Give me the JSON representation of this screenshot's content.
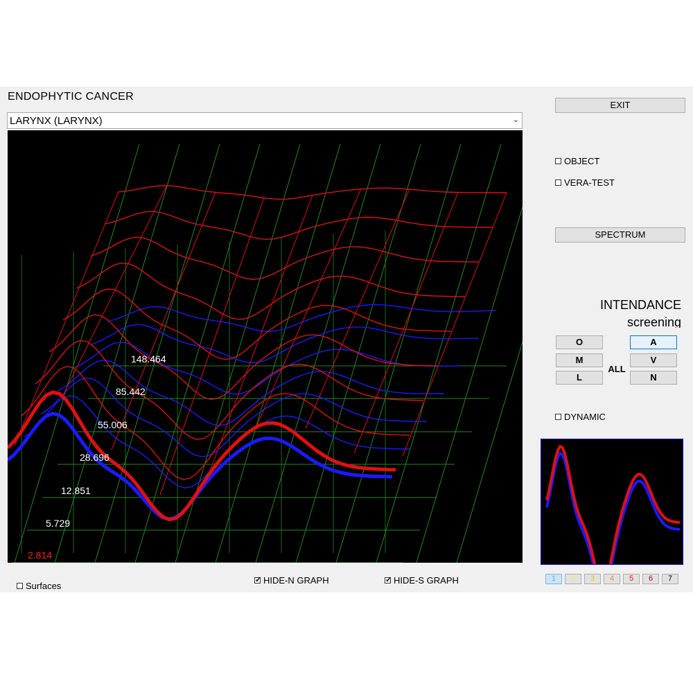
{
  "header": {
    "title": "ENDOPHYTIC  CANCER"
  },
  "organ_select": {
    "value": "LARYNX  (LARYNX)"
  },
  "plot": {
    "level_labels": [
      {
        "text": "148.464",
        "color": "#ffffff"
      },
      {
        "text": "85.442",
        "color": "#ffffff"
      },
      {
        "text": "55.006",
        "color": "#ffffff"
      },
      {
        "text": "28.696",
        "color": "#ffffff"
      },
      {
        "text": "12.851",
        "color": "#ffffff"
      },
      {
        "text": "5.729",
        "color": "#ffffff"
      },
      {
        "text": "2.814",
        "color": "#ff2020"
      }
    ],
    "colors": {
      "grid": "#1f8a1f",
      "surface_s": "#e01010",
      "surface_n": "#1a1aff",
      "background": "#000000"
    }
  },
  "right_panel": {
    "exit_label": "EXIT",
    "object_label": "OBJECT",
    "object_checked": false,
    "vera_label": "VERA-TEST",
    "vera_checked": false,
    "spectrum_label": "SPECTRUM",
    "intendance_title": "INTENDANCE",
    "intendance_subtitle": "screening",
    "buttons": {
      "o": "O",
      "m": "M",
      "l": "L",
      "all": "ALL",
      "a": "A",
      "v": "V",
      "n": "N"
    },
    "selected_button": "A",
    "dynamic_label": "DYNAMIC",
    "dynamic_checked": false,
    "pages": [
      {
        "label": "1",
        "color": "#6fa8dc"
      },
      {
        "label": "2",
        "color": "#f1e27a"
      },
      {
        "label": "3",
        "color": "#e6c200"
      },
      {
        "label": "4",
        "color": "#f08a2c"
      },
      {
        "label": "5",
        "color": "#e02020"
      },
      {
        "label": "6",
        "color": "#8b1a1a"
      },
      {
        "label": "7",
        "color": "#000000"
      }
    ],
    "selected_page": "1"
  },
  "bottom": {
    "surfaces_label": "Surfaces",
    "surfaces_checked": false,
    "hide_n_label": "HIDE-N GRAPH",
    "hide_n_checked": true,
    "hide_s_label": "HIDE-S GRAPH",
    "hide_s_checked": true
  }
}
